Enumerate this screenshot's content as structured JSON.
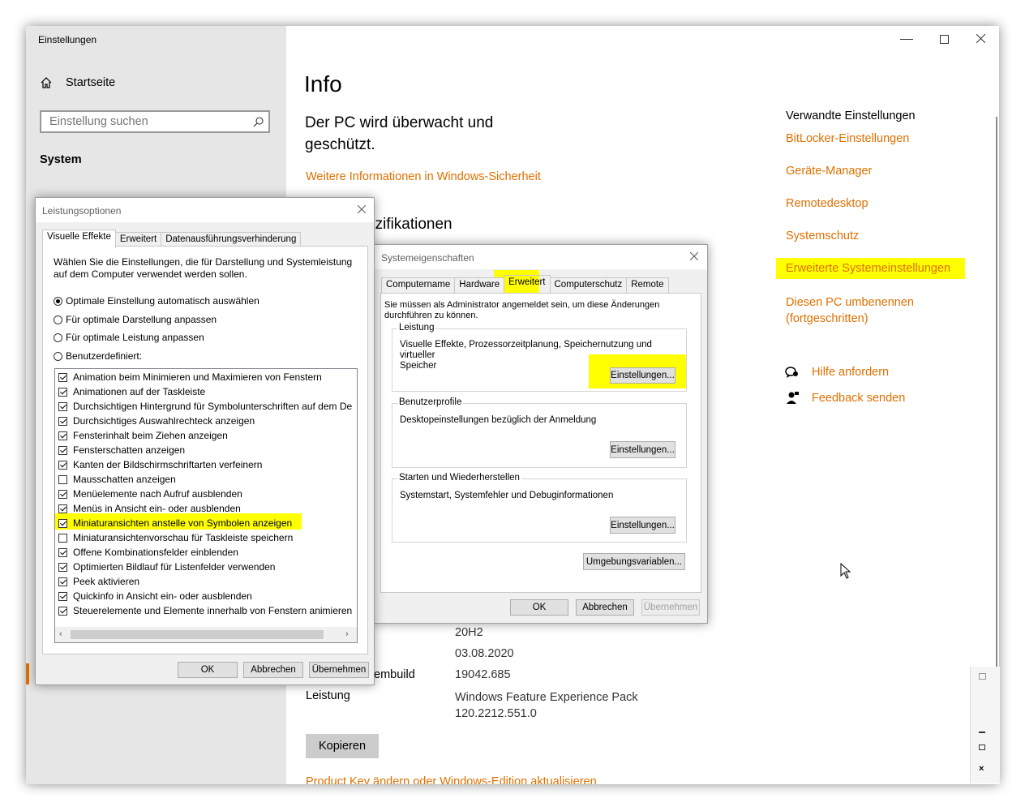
{
  "settings": {
    "window_title": "Einstellungen",
    "home_label": "Startseite",
    "search_placeholder": "Einstellung suchen",
    "category": "System",
    "page_title": "Info",
    "protection_text_line1": "Der PC wird überwacht und",
    "protection_text_line2": "geschützt.",
    "security_link": "Weitere Informationen in Windows-Sicherheit",
    "spec_heading_partial": "ezifikationen",
    "specs": [
      {
        "label": "",
        "value": "20H2"
      },
      {
        "label": "",
        "value": "03.08.2020"
      },
      {
        "label": "embuild",
        "value": "19042.685"
      },
      {
        "label": "Leistung",
        "value": "Windows Feature Experience Pack",
        "value2": "120.2212.551.0"
      }
    ],
    "copy_button": "Kopieren",
    "bottom_link_partial": "Product Key ändern oder Windows-Edition aktualisieren",
    "related_heading": "Verwandte Einstellungen",
    "related_links": [
      "BitLocker-Einstellungen",
      "Geräte-Manager",
      "Remotedesktop",
      "Systemschutz",
      "Erweiterte Systemeinstellungen",
      "Diesen PC umbenennen",
      "(fortgeschritten)"
    ],
    "help_link": "Hilfe anfordern",
    "feedback_link": "Feedback senden",
    "accent_color": "#e07000",
    "highlight_color": "#ffff00"
  },
  "perf": {
    "title": "Leistungsoptionen",
    "tabs": [
      "Visuelle Effekte",
      "Erweitert",
      "Datenausführungsverhinderung"
    ],
    "description": "Wählen Sie die Einstellungen, die für Darstellung und Systemleistung auf dem Computer verwendet werden sollen.",
    "radios": [
      {
        "label": "Optimale Einstellung automatisch auswählen",
        "selected": true
      },
      {
        "label": "Für optimale Darstellung anpassen",
        "selected": false
      },
      {
        "label": "Für optimale Leistung anpassen",
        "selected": false
      },
      {
        "label": "Benutzerdefiniert:",
        "selected": false
      }
    ],
    "checkboxes": [
      {
        "label": "Animation beim Minimieren und Maximieren von Fenstern",
        "checked": true
      },
      {
        "label": "Animationen auf der Taskleiste",
        "checked": true
      },
      {
        "label": "Durchsichtigen Hintergrund für Symbolunterschriften auf dem De",
        "checked": true
      },
      {
        "label": "Durchsichtiges Auswahlrechteck anzeigen",
        "checked": true
      },
      {
        "label": "Fensterinhalt beim Ziehen anzeigen",
        "checked": true
      },
      {
        "label": "Fensterschatten anzeigen",
        "checked": true
      },
      {
        "label": "Kanten der Bildschirmschriftarten verfeinern",
        "checked": true
      },
      {
        "label": "Mausschatten anzeigen",
        "checked": false
      },
      {
        "label": "Menüelemente nach Aufruf ausblenden",
        "checked": true
      },
      {
        "label": "Menüs in Ansicht ein- oder ausblenden",
        "checked": true
      },
      {
        "label": "Miniaturansichten anstelle von Symbolen anzeigen",
        "checked": true,
        "highlighted": true
      },
      {
        "label": "Miniaturansichtenvorschau für Taskleiste speichern",
        "checked": false
      },
      {
        "label": "Offene Kombinationsfelder einblenden",
        "checked": true
      },
      {
        "label": "Optimierten Bildlauf für Listenfelder verwenden",
        "checked": true
      },
      {
        "label": "Peek aktivieren",
        "checked": true
      },
      {
        "label": "Quickinfo in Ansicht ein- oder ausblenden",
        "checked": true
      },
      {
        "label": "Steuerelemente und Elemente innerhalb von Fenstern animieren",
        "checked": true
      }
    ],
    "ok": "OK",
    "cancel": "Abbrechen",
    "apply": "Übernehmen"
  },
  "sysprops": {
    "title": "Systemeigenschaften",
    "tabs": [
      "Computername",
      "Hardware",
      "Erweitert",
      "Computerschutz",
      "Remote"
    ],
    "admin_note_line1": "Sie müssen als Administrator angemeldet sein, um diese Änderungen",
    "admin_note_line2": "durchführen zu können.",
    "groups": [
      {
        "label": "Leistung",
        "text_line1": "Visuelle Effekte, Prozessorzeitplanung, Speichernutzung und virtueller",
        "text_line2": "Speicher",
        "button": "Einstellungen..."
      },
      {
        "label": "Benutzerprofile",
        "text_line1": "Desktopeinstellungen bezüglich der Anmeldung",
        "text_line2": "",
        "button": "Einstellungen..."
      },
      {
        "label": "Starten und Wiederherstellen",
        "text_line1": "Systemstart, Systemfehler und Debuginformationen",
        "text_line2": "",
        "button": "Einstellungen..."
      }
    ],
    "env_button": "Umgebungsvariablen...",
    "ok": "OK",
    "cancel": "Abbrechen",
    "apply": "Übernehmen"
  }
}
